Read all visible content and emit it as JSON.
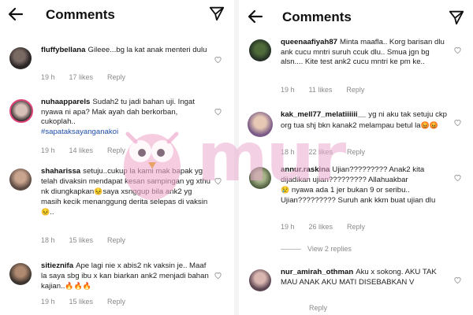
{
  "left": {
    "header": {
      "title": "Comments"
    },
    "comments": [
      {
        "user": "fluffybellana",
        "text": "Gileee...bg la kat anak menteri dulu",
        "time": "19 h",
        "likes": "17 likes",
        "reply": "Reply"
      },
      {
        "user": "nuhaapparels",
        "text": "Sudah2 tu jadi bahan uji. Ingat nyawa ni apa? Mak ayah dah berkorban, cukoplah..",
        "hashtag": "#sapataksayanganakoi",
        "time": "19 h",
        "likes": "14 likes",
        "reply": "Reply"
      },
      {
        "user": "shaharissa",
        "text": "setuju..cukup la kami mak bapak yg telah divaksin mendapat kesan sampingan yg xthu nk diungkapkan",
        "text2": "saya xsnggup bila ank2 yg masih kecik menanggung derita selepas di vaksin",
        "emoji1": "😣",
        "emoji2": "😣",
        "tail": "..",
        "time": "18 h",
        "likes": "15 likes",
        "reply": "Reply"
      },
      {
        "user": "sitieznifa",
        "text": "Ape lagi nie x abis2 nk vaksin je.. Maaf la saya sbg ibu x kan biarkan ank2 menjadi bahan kajian..",
        "emoji": "🔥🔥🔥",
        "time": "19 h",
        "likes": "15 likes",
        "reply": "Reply"
      }
    ]
  },
  "right": {
    "header": {
      "title": "Comments"
    },
    "comments": [
      {
        "user": "queenaafiyah87",
        "text": "Minta maafla.. Korg barisan dlu ank cucu mntri suruh ccuk dlu.. Smua jgn bg alsn.... Kite test ank2 cucu mntri ke pm ke..",
        "time": "19 h",
        "likes": "11 likes",
        "reply": "Reply"
      },
      {
        "user": "kak_mell77_melatiiiiii__",
        "text": "yg ni aku tak setuju ckp org tua shj bkn kanak2 melampau betul la",
        "emoji": "😡😡",
        "time": "18 h",
        "likes": "22 likes",
        "reply": "Reply"
      },
      {
        "user": "annur.raskina",
        "text": "Ujian????????? Anak2 kita dijadikan ujian????????? Allahuakbar",
        "emoji": "😢",
        "text2": "nyawa ada 1 jer bukan 9 or seribu.. Ujian????????? Suruh ank kkm buat ujian dlu",
        "time": "19 h",
        "likes": "26 likes",
        "reply": "Reply",
        "view_replies": "View 2 replies"
      },
      {
        "user": "nur_amirah_othman",
        "text": "Aku x sokong. AKU TAK MAU ANAK AKU MATI DISEBABKAN V",
        "time": "",
        "likes": "",
        "reply": "Reply"
      }
    ]
  },
  "watermark": "mur",
  "colors": {
    "link": "#1f4fa8",
    "meta": "#8a8a8a",
    "watermark": "#e9aacd"
  }
}
